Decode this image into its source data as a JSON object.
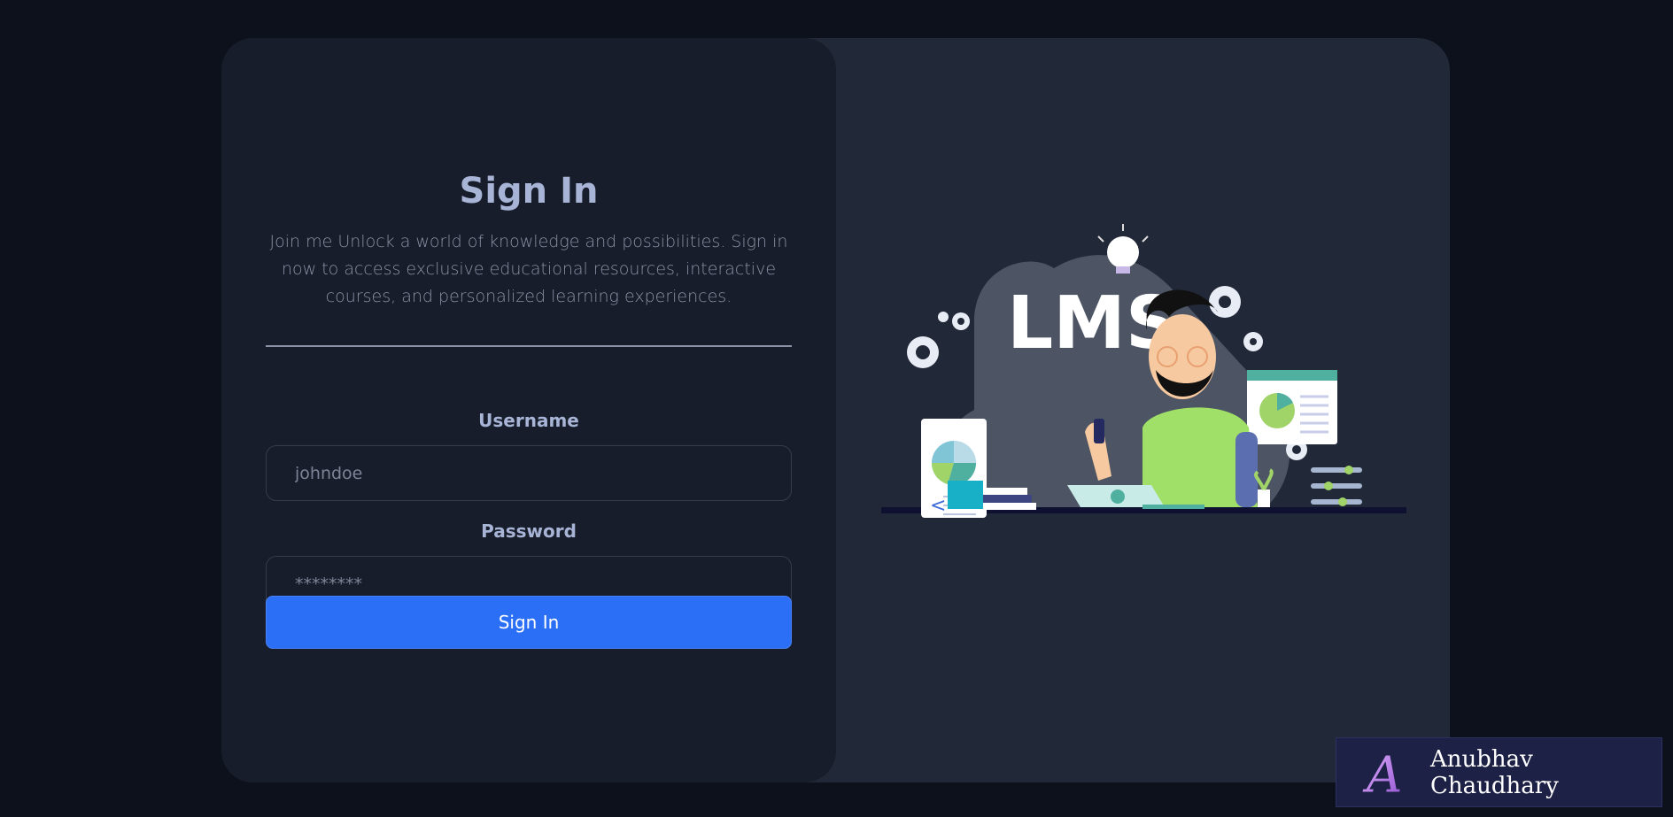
{
  "signin": {
    "title": "Sign In",
    "description": "Join me Unlock a world of knowledge and possibilities. Sign in now to access exclusive educational resources, interactive courses, and personalized learning experiences.",
    "username_label": "Username",
    "username_placeholder": "johndoe",
    "password_label": "Password",
    "password_placeholder": "********",
    "button_label": "Sign In"
  },
  "illustration": {
    "text": "LMS"
  },
  "badge": {
    "logo_letter": "A",
    "name": "Anubhav Chaudhary"
  },
  "colors": {
    "background": "#0c111b",
    "card": "#212837",
    "panel": "#171d2a",
    "accent": "#2b6ff7",
    "title": "#a8b4d6"
  }
}
